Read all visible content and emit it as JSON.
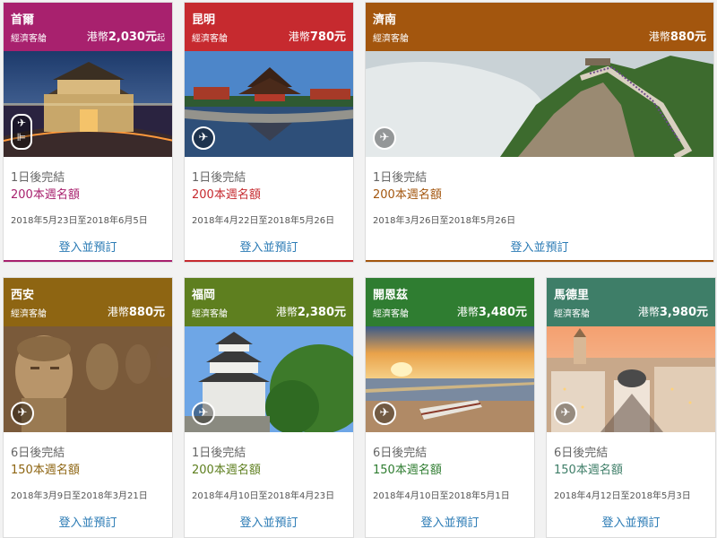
{
  "cards": [
    {
      "city": "首爾",
      "cabin": "經濟客艙",
      "currency": "港幣",
      "price": "2,030元",
      "price_suffix": "起",
      "days_left": "1日後完結",
      "seats": "200本週名額",
      "date_range": "2018年5月23日至2018年6月5日",
      "book_label": "登入並預訂",
      "header_color": "#a8216e",
      "seats_color": "#a8216e",
      "icon": "plane-icon"
    },
    {
      "city": "昆明",
      "cabin": "經濟客艙",
      "currency": "港幣",
      "price": "780元",
      "price_suffix": "",
      "days_left": "1日後完結",
      "seats": "200本週名額",
      "date_range": "2018年4月22日至2018年5月26日",
      "book_label": "登入並預訂",
      "header_color": "#c62a2f",
      "seats_color": "#c62a2f",
      "icon": "plane-icon"
    },
    {
      "city": "濟南",
      "cabin": "經濟客艙",
      "currency": "港幣",
      "price": "880元",
      "price_suffix": "",
      "days_left": "1日後完結",
      "seats": "200本週名額",
      "date_range": "2018年3月26日至2018年5月26日",
      "book_label": "登入並預訂",
      "header_color": "#a3560e",
      "seats_color": "#a3560e",
      "icon": "plane-icon"
    },
    {
      "city": "西安",
      "cabin": "經濟客艙",
      "currency": "港幣",
      "price": "880元",
      "price_suffix": "",
      "days_left": "6日後完結",
      "seats": "150本週名額",
      "date_range": "2018年3月9日至2018年3月21日",
      "book_label": "登入並預訂",
      "header_color": "#8e6512",
      "seats_color": "#8e6512",
      "icon": "plane-icon"
    },
    {
      "city": "福岡",
      "cabin": "經濟客艙",
      "currency": "港幣",
      "price": "2,380元",
      "price_suffix": "",
      "days_left": "1日後完結",
      "seats": "200本週名額",
      "date_range": "2018年4月10日至2018年4月23日",
      "book_label": "登入並預訂",
      "header_color": "#5e7f1f",
      "seats_color": "#5e7f1f",
      "icon": "plane-icon"
    },
    {
      "city": "開恩茲",
      "cabin": "經濟客艙",
      "currency": "港幣",
      "price": "3,480元",
      "price_suffix": "",
      "days_left": "6日後完結",
      "seats": "150本週名額",
      "date_range": "2018年4月10日至2018年5月1日",
      "book_label": "登入並預訂",
      "header_color": "#2f7d31",
      "seats_color": "#2f7d31",
      "icon": "plane-icon"
    },
    {
      "city": "馬德里",
      "cabin": "經濟客艙",
      "currency": "港幣",
      "price": "3,980元",
      "price_suffix": "",
      "days_left": "6日後完結",
      "seats": "150本週名額",
      "date_range": "2018年4月12日至2018年5月3日",
      "book_label": "登入並預訂",
      "header_color": "#3e7e68",
      "seats_color": "#3e7e68",
      "icon": "plane-icon"
    }
  ]
}
